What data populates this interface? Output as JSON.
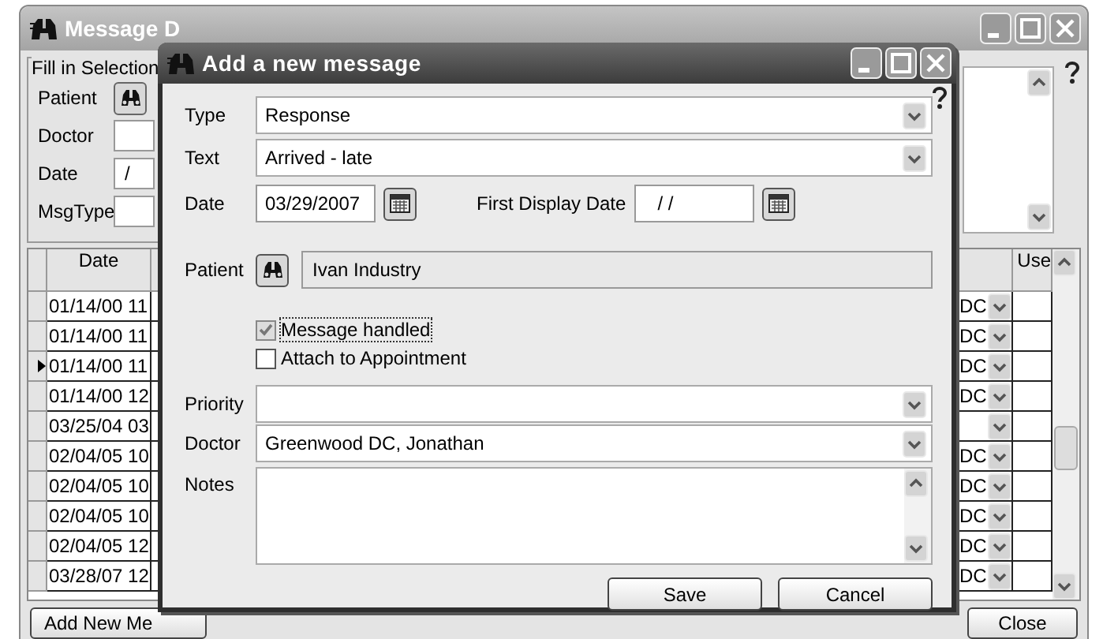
{
  "background_window": {
    "title": "Message D",
    "filter": {
      "legend": "Fill in Selection",
      "fields": [
        {
          "label": "Patient",
          "kind": "lookup"
        },
        {
          "label": "Doctor",
          "kind": "text"
        },
        {
          "label": "Date",
          "kind": "text",
          "value": "/"
        },
        {
          "label": "MsgType",
          "kind": "text"
        }
      ]
    },
    "grid": {
      "columns": [
        {
          "label": "Date"
        },
        {
          "label": "Use"
        }
      ],
      "rows": [
        {
          "date": "01/14/00 11",
          "doctor": "DC",
          "current": false
        },
        {
          "date": "01/14/00 11",
          "doctor": "DC",
          "current": false
        },
        {
          "date": "01/14/00 11",
          "doctor": "DC",
          "current": true
        },
        {
          "date": "01/14/00 12",
          "doctor": "DC",
          "current": false
        },
        {
          "date": "03/25/04 03",
          "current": false
        },
        {
          "date": "02/04/05 10",
          "doctor": "DC",
          "current": false
        },
        {
          "date": "02/04/05 10",
          "doctor": "DC",
          "current": false
        },
        {
          "date": "02/04/05 10",
          "doctor": "DC",
          "current": false
        },
        {
          "date": "02/04/05 12",
          "doctor": "DC",
          "current": false
        },
        {
          "date": "03/28/07 12",
          "doctor": "DC",
          "current": false
        }
      ]
    },
    "buttons": [
      {
        "label": "Add New Me"
      },
      {
        "label": "Close"
      }
    ]
  },
  "dialog": {
    "title": "Add a new message",
    "type": {
      "label": "Type",
      "value": "Response"
    },
    "text": {
      "label": "Text",
      "value": "Arrived - late"
    },
    "date": {
      "label": "Date",
      "value": "03/29/2007"
    },
    "first_display_date": {
      "label": "First Display Date",
      "value": "/ /"
    },
    "patient": {
      "label": "Patient",
      "value": "Ivan Industry"
    },
    "checkboxes": [
      {
        "label": "Message handled",
        "checked": true
      },
      {
        "label": "Attach to Appointment",
        "checked": false
      }
    ],
    "priority": {
      "label": "Priority"
    },
    "doctor": {
      "label": "Doctor",
      "value": "Greenwood DC, Jonathan"
    },
    "notes": {
      "label": "Notes"
    },
    "buttons": [
      {
        "label": "Save"
      },
      {
        "label": "Cancel"
      }
    ]
  }
}
